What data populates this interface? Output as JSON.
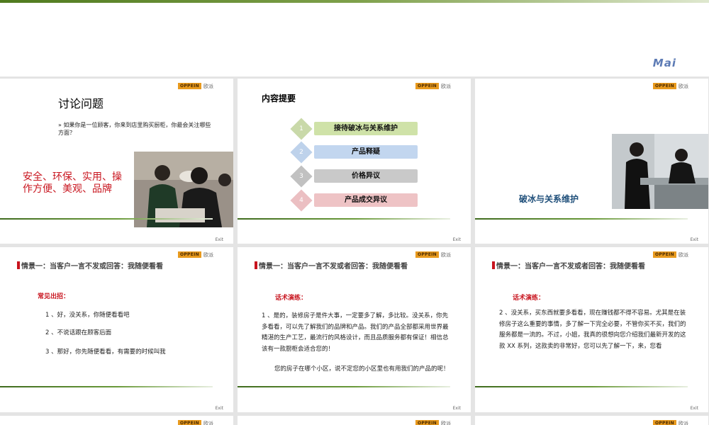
{
  "header": {
    "mai_logo": "Mai"
  },
  "brand": {
    "logo_box": "OPPEIN",
    "logo_cn": "欧派"
  },
  "exit_label": "Exit",
  "slide1": {
    "title": "讨论问题",
    "bullet": "» 如果你是一位顾客，你来到店里购买厨柜，你最会关注哪些方面？",
    "answer": "安全、环保、实用、操作方便、美观、品牌"
  },
  "slide2": {
    "title": "内容提要",
    "items": [
      {
        "num": "1",
        "label": "接待破冰与关系维护",
        "color": "#cfe2a8",
        "num_color": "#9dbb63"
      },
      {
        "num": "2",
        "label": "产品释疑",
        "color": "#c2d6ef",
        "num_color": "#8aaedb"
      },
      {
        "num": "3",
        "label": "价格异议",
        "color": "#c9c9c9",
        "num_color": "#8f8f8f"
      },
      {
        "num": "4",
        "label": "产品成交异议",
        "color": "#eec3c5",
        "num_color": "#dc8c92"
      }
    ]
  },
  "slide3": {
    "title": "破冰与关系维护"
  },
  "slide4": {
    "title": "情景一：当客户一言不发或回答：我随便看看",
    "subtitle": "常见出招：",
    "lines": [
      "1 、好，没关系，你随便看看吧",
      "2 、不说话跟在顾客后面",
      "3 、那好，你先随便看看，有需要的时候叫我"
    ]
  },
  "slide5": {
    "title": "情景一：当客户一言不发或者回答：我随便看看",
    "subtitle": "话术演练：",
    "body": "1 、是的，装修房子是件大事，一定要多了解，多比较。没关系，你先多看看，可以先了解我们的品牌和产品。我们的产品全部都采用世界最精湛的生产工艺，最流行的风格设计，而且品质服务都有保证！相信总该有一款厨柜会适合您的！",
    "body2": "您的房子在哪个小区，说不定您的小区里也有用我们的产品的呢！"
  },
  "slide6": {
    "title": "情景一：当客户一言不发或者回答：我随便看看",
    "subtitle": "话术演练：",
    "body": "2 、没关系，买东西就要多看看，现在赚钱都不得不容易。尤其是在装修房子这么重要的事情，多了解一下完全必要，不管你买不买，我们的服务都是一流的。不过，小姐，我真的很想向您介绍我们最新开发的这款 XX 系列，这款卖的非常好，您可以先了解一下，来，您看"
  }
}
